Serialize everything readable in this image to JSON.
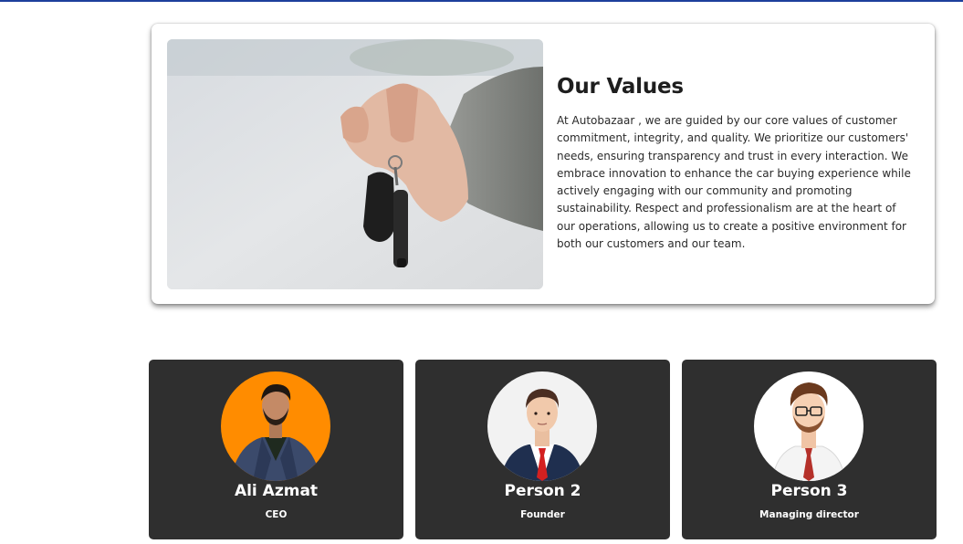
{
  "values": {
    "image_alt": "Hand holding car keys",
    "title": "Our Values",
    "body": "At Autobazaar , we are guided by our core values of customer commitment, integrity, and quality. We prioritize our customers' needs, ensuring transparency and trust in every interaction. We embrace innovation to enhance the car buying experience while actively engaging with our community and promoting sustainability. Respect and professionalism are at the heart of our operations, allowing us to create a positive environment for both our customers and our team."
  },
  "team": [
    {
      "name": "Ali Azmat",
      "role": "CEO",
      "avatar_bg": "#ff8c00"
    },
    {
      "name": "Person 2",
      "role": "Founder",
      "avatar_bg": "#f2f2f2"
    },
    {
      "name": "Person 3",
      "role": "Managing director",
      "avatar_bg": "#ffffff"
    }
  ],
  "colors": {
    "accent": "#1d3f9c",
    "card_dark": "#2f2f2f"
  }
}
